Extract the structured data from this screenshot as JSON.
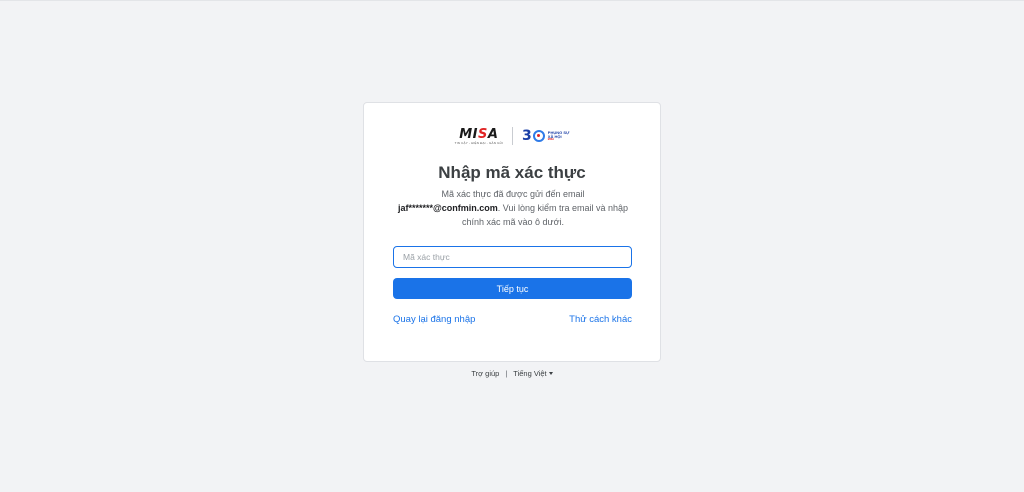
{
  "logo": {
    "brand_prefix": "MI",
    "brand_accent": "S",
    "brand_suffix": "A",
    "brand_tagline": "TIN CẬY - HIỆN ĐẠI - GẦN GŨI",
    "anniversary_number": "3",
    "anniversary_line1": "PHỤNG SỰ",
    "anniversary_line2": "XÃ HỘI",
    "anniversary_line3": "MISA"
  },
  "card": {
    "title": "Nhập mã xác thực",
    "desc_line1": "Mã xác thực đã được gửi đến email",
    "desc_email": "jaf*******@confmin.com",
    "desc_line2": ". Vui lòng kiểm tra email và nhập chính xác mã vào ô dưới.",
    "code_input_placeholder": "Mã xác thực",
    "code_input_value": "",
    "continue_label": "Tiếp tục",
    "back_to_login_label": "Quay lại đăng nhập",
    "try_other_label": "Thử cách khác"
  },
  "footer": {
    "help_label": "Trợ giúp",
    "separator": "|",
    "language_label": "Tiếng Việt"
  },
  "colors": {
    "primary": "#1a73e8",
    "background": "#f2f3f5",
    "brand_red": "#e02424",
    "brand_blue": "#1b3fa6"
  },
  "icons": {
    "language_dropdown": "caret-down-icon"
  }
}
